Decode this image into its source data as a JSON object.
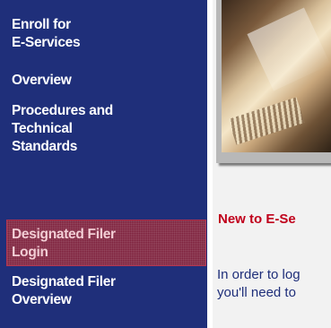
{
  "sidebar": {
    "items": [
      {
        "label": "Enroll for\nE-Services"
      },
      {
        "label": "Overview"
      },
      {
        "label": "Procedures and\nTechnical\nStandards"
      },
      {
        "label": "Designated Filer\nLogin",
        "active": true
      },
      {
        "label": "Designated Filer\nOverview"
      }
    ]
  },
  "main": {
    "headline": "New to E-Se",
    "body": "In order to log\nyou'll need to"
  },
  "colors": {
    "sidebar_bg": "#1f2f7a",
    "active_bg": "#7d1f3b",
    "headline": "#c0001b"
  }
}
